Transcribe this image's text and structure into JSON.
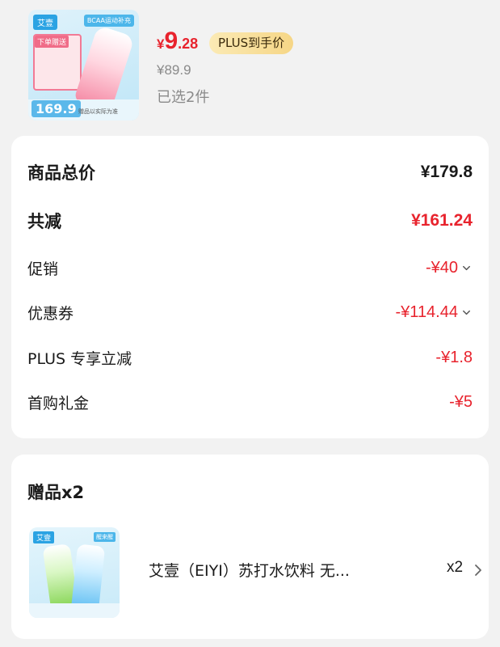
{
  "product": {
    "image": {
      "tag_brand": "艾壹",
      "tag_corner": "BCAA运动补充",
      "promo_head": "下单赠送",
      "price_badge": "169.9",
      "note": "赠品以实际为准"
    },
    "price_symbol": "¥",
    "price_int": "9",
    "price_dec": ".28",
    "plus_badge": "PLUS到手价",
    "original_price": "¥89.9",
    "selected": "已选2件"
  },
  "summary": {
    "total_label": "商品总价",
    "total_value": "¥179.8",
    "discount_label": "共减",
    "discount_value": "¥161.24",
    "items": [
      {
        "label": "促销",
        "value": "-¥40",
        "expandable": true
      },
      {
        "label": "优惠券",
        "value": "-¥114.44",
        "expandable": true
      },
      {
        "label": "PLUS 专享立减",
        "value": "-¥1.8",
        "expandable": false
      },
      {
        "label": "首购礼金",
        "value": "-¥5",
        "expandable": false
      }
    ]
  },
  "gifts": {
    "title": "赠品x2",
    "item": {
      "image_tag": "艾壹",
      "image_tag2": "醒来醒",
      "name": "艾壹（EIYI）苏打水饮料 无...",
      "qty": "x2"
    }
  },
  "colors": {
    "red": "#e8232d",
    "plus_gold": "#f6d686",
    "card_bg": "#ffffff",
    "page_bg": "#f2f2f2"
  }
}
